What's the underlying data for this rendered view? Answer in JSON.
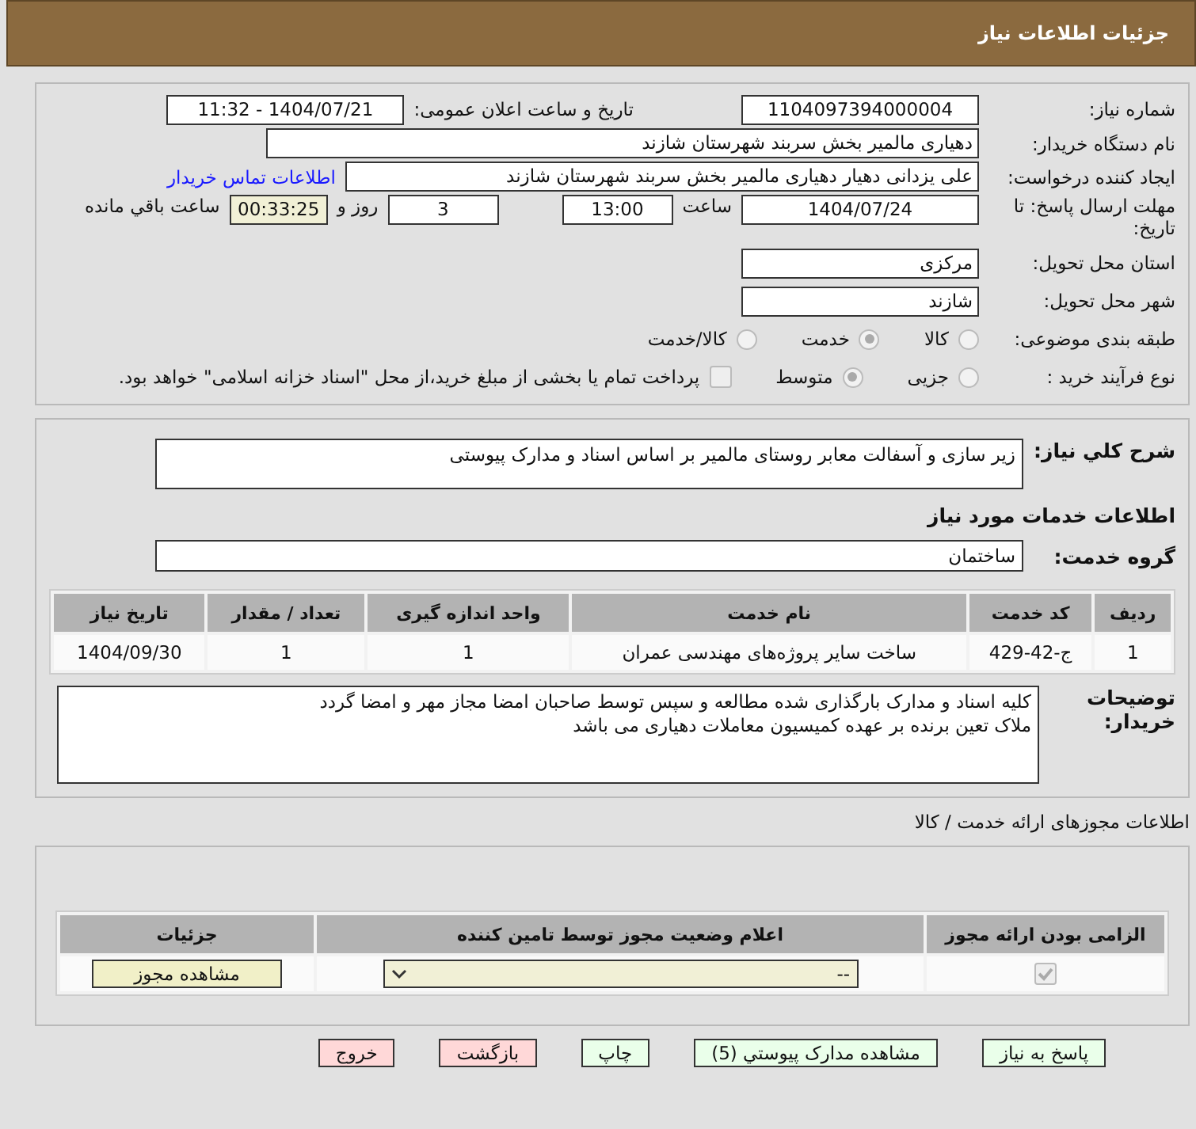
{
  "header": {
    "title": "جزئیات اطلاعات نیاز"
  },
  "info": {
    "need_number": {
      "label": "شماره نیاز:",
      "value": "1104097394000004"
    },
    "announce": {
      "label": "تاریخ و ساعت اعلان عمومی:",
      "value": "1404/07/21 - 11:32"
    },
    "buyer": {
      "label": "نام دستگاه خریدار:",
      "value": "دهیاری مالمیر بخش سربند شهرستان شازند"
    },
    "requester": {
      "label": "ایجاد کننده درخواست:",
      "value": "علی یزدانی دهیار دهیاری مالمیر بخش سربند شهرستان شازند",
      "link": "اطلاعات تماس خریدار"
    },
    "deadline": {
      "label": "مهلت ارسال پاسخ: تا تاریخ:",
      "date": "1404/07/24",
      "time_label": "ساعت",
      "time": "13:00",
      "days": "3",
      "days_label": "روز و",
      "remaining": "00:33:25",
      "remaining_label": "ساعت باقي مانده"
    },
    "province": {
      "label": "استان محل تحویل:",
      "value": "مرکزی"
    },
    "city": {
      "label": "شهر محل تحویل:",
      "value": "شازند"
    },
    "category": {
      "label": "طبقه بندی موضوعی:",
      "options": [
        {
          "label": "کالا",
          "selected": false
        },
        {
          "label": "خدمت",
          "selected": true
        },
        {
          "label": "کالا/خدمت",
          "selected": false
        }
      ]
    },
    "process": {
      "label": "نوع فرآیند خرید :",
      "options": [
        {
          "label": "جزیی",
          "selected": false
        },
        {
          "label": "متوسط",
          "selected": true
        }
      ],
      "payment": {
        "label": "پرداخت تمام یا بخشی از مبلغ خرید،از محل \"اسناد خزانه اسلامی\" خواهد بود.",
        "checked": false
      }
    }
  },
  "description": {
    "label": "شرح کلي نياز:",
    "value": "زیر سازی و آسفالت معابر روستای مالمیر بر اساس اسناد و مدارک پیوستی"
  },
  "services_title": "اطلاعات خدمات مورد نیاز",
  "service_group": {
    "label": "گروه خدمت:",
    "value": "ساختمان"
  },
  "table": {
    "columns": [
      "ردیف",
      "کد خدمت",
      "نام خدمت",
      "واحد اندازه گیری",
      "تعداد / مقدار",
      "تاریخ نیاز"
    ],
    "rows": [
      [
        "1",
        "ج-42-429",
        "ساخت سایر پروژه‌های مهندسی عمران",
        "1",
        "1",
        "1404/09/30"
      ]
    ]
  },
  "buyer_notes": {
    "label": "توضیحات خریدار:",
    "lines": [
      "کلیه اسناد و مدارک بارگذاری شده مطالعه و سپس توسط صاحبان امضا مجاز مهر و امضا گردد",
      "ملاک تعین برنده بر عهده کمیسیون معاملات دهیاری می باشد"
    ]
  },
  "permits": {
    "title": "اطلاعات مجوزهای ارائه خدمت / کالا",
    "columns": [
      "الزامی بودن ارائه مجوز",
      "اعلام وضعیت مجوز توسط تامین کننده",
      "جزئیات"
    ],
    "rows": [
      {
        "required": true,
        "status": "--",
        "button": "مشاهده مجوز"
      }
    ]
  },
  "buttons": [
    {
      "label": "پاسخ به نیاز",
      "kind": "green"
    },
    {
      "label": "مشاهده مدارک پیوستي (5)",
      "kind": "green"
    },
    {
      "label": "چاپ",
      "kind": "green"
    },
    {
      "label": "بازگشت",
      "kind": "red"
    },
    {
      "label": "خروج",
      "kind": "red"
    }
  ]
}
